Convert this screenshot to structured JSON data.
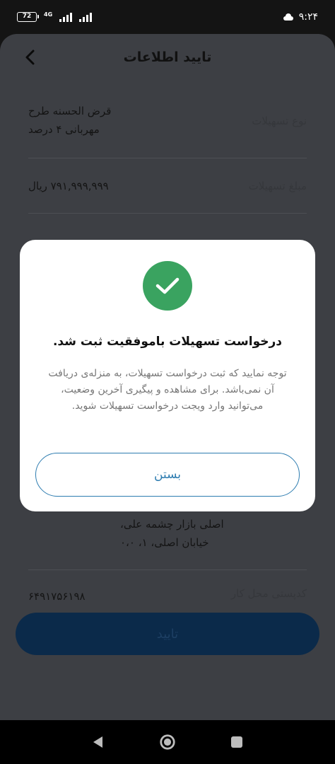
{
  "status_bar": {
    "battery": "72",
    "network": "4G",
    "time": "۹:۲۴"
  },
  "page": {
    "title": "تایید اطلاعات",
    "rows": [
      {
        "label": "نوع تسهیلات",
        "value_line1": "قرض الحسنه طرح",
        "value_line2": "مهربانی ۴ درصد"
      },
      {
        "label": "مبلغ تسهیلات",
        "value_line1": "۷۹۱,۹۹۹,۹۹۹ ریال"
      },
      {
        "label": "",
        "value_line1": "اصلی بازار چشمه علی،",
        "value_line2": "خیابان اصلی، ۱، ۰،۰"
      },
      {
        "label": "کدپستی محل کار",
        "value_line1": "۶۴۹۱۷۵۶۱۹۸"
      }
    ],
    "confirm_label": "تایید"
  },
  "dialog": {
    "title": "درخواست تسهیلات باموفقیت ثبت شد.",
    "message": "توجه نمایید که ثبت درخواست تسهیلات، به منزله‌ی دریافت آن نمی‌باشد. برای مشاهده و پیگیری آخرین وضعیت، می‌توانید وارد ویجت درخواست تسهیلات شوید.",
    "close_label": "بستن",
    "success_color": "#3aa360",
    "accent_color": "#2d7cb0"
  }
}
